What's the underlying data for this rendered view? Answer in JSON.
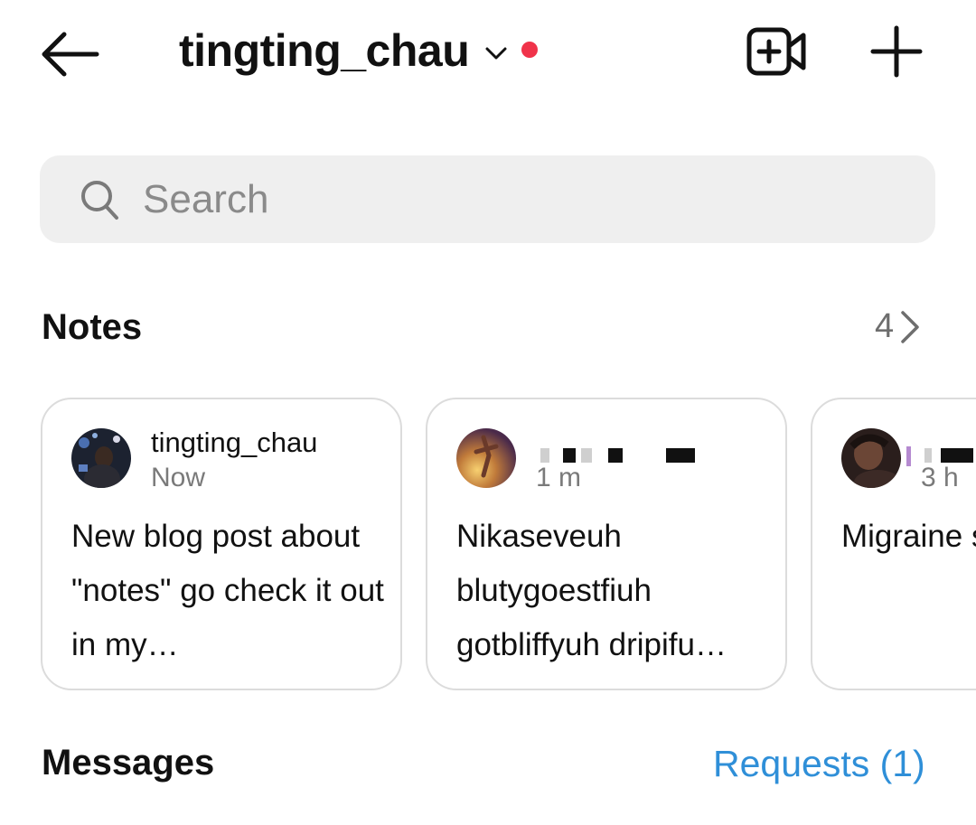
{
  "header": {
    "username": "tingting_chau"
  },
  "search": {
    "placeholder": "Search"
  },
  "notes": {
    "heading": "Notes",
    "count": "4",
    "items": [
      {
        "username": "tingting_chau",
        "time": "Now",
        "text": "New blog post about \"notes\" go check it out in my…"
      },
      {
        "username": "",
        "time": "1 m",
        "text": "Nikaseveuh blutygoestfiuh gotbliffyuh dripifu…"
      },
      {
        "username": "",
        "time": "3 h",
        "text": "Migraine szn = a c"
      }
    ]
  },
  "messages": {
    "heading": "Messages",
    "requests_label": "Requests (1)"
  },
  "colors": {
    "accent_blue": "#2f8fd8",
    "status_dot_red": "#f0334a",
    "search_bg": "#efefef"
  },
  "icons": [
    "back-arrow-icon",
    "chevron-down-icon",
    "video-add-icon",
    "plus-icon",
    "search-icon",
    "chevron-right-icon"
  ]
}
